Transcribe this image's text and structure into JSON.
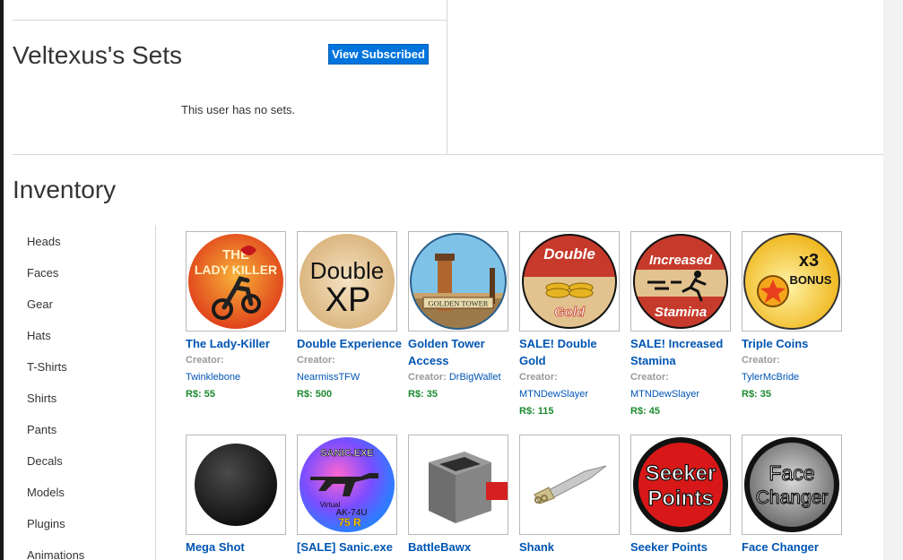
{
  "sets": {
    "title": "Veltexus's Sets",
    "view_subscribed_label": "View Subscribed",
    "empty_message": "This user has no sets."
  },
  "inventory": {
    "title": "Inventory",
    "categories": [
      "Heads",
      "Faces",
      "Gear",
      "Hats",
      "T-Shirts",
      "Shirts",
      "Pants",
      "Decals",
      "Models",
      "Plugins",
      "Animations"
    ],
    "items": [
      {
        "name": "The Lady-Killer",
        "creator_label": "Creator:",
        "creator": "Twinklebone",
        "price": "R$: 55",
        "icon": "lady-killer-motorcycle"
      },
      {
        "name": "Double Experience",
        "creator_label": "Creator:",
        "creator": "NearmissTFW",
        "price": "R$: 500",
        "icon": "double-xp-badge",
        "icon_text_1": "Double",
        "icon_text_2": "XP"
      },
      {
        "name": "Golden Tower Access",
        "creator_label": "Creator:",
        "creator": "DrBigWallet",
        "price": "R$: 35",
        "icon": "golden-tower-badge",
        "icon_text": "GOLDEN TOWER"
      },
      {
        "name": "SALE! Double Gold",
        "creator_label": "Creator:",
        "creator": "MTNDewSlayer",
        "price": "R$: 115",
        "icon": "double-gold-badge",
        "icon_text_1": "Double",
        "icon_text_2": "Gold"
      },
      {
        "name": "SALE! Increased Stamina",
        "creator_label": "Creator:",
        "creator": "MTNDewSlayer",
        "price": "R$: 45",
        "icon": "increased-stamina-badge",
        "icon_text_1": "Increased",
        "icon_text_2": "Stamina"
      },
      {
        "name": "Triple Coins",
        "creator_label": "Creator:",
        "creator": "TylerMcBride",
        "price": "R$: 35",
        "icon": "triple-coins-badge",
        "icon_text_1": "x3",
        "icon_text_2": "BONUS"
      },
      {
        "name": "Mega Shot",
        "icon": "black-sphere"
      },
      {
        "name": "[SALE] Sanic.exe",
        "icon": "sanic-ak74u-badge",
        "icon_text_1": "SANIC.EXE",
        "icon_text_2": "Virtual",
        "icon_text_3": "AK-74U",
        "icon_text_4": "75 R"
      },
      {
        "name": "BattleBawx",
        "icon": "battlebawx-cube"
      },
      {
        "name": "Shank",
        "icon": "shank-knife"
      },
      {
        "name": "Seeker Points",
        "icon": "seeker-points-badge",
        "icon_text_1": "Seeker",
        "icon_text_2": "Points"
      },
      {
        "name": "Face Changer",
        "icon": "face-changer-badge",
        "icon_text_1": "Face",
        "icon_text_2": "Changer"
      }
    ]
  },
  "colors": {
    "accent_button": "#0074dd",
    "link": "#0055b3",
    "price": "#1a8a2e"
  }
}
